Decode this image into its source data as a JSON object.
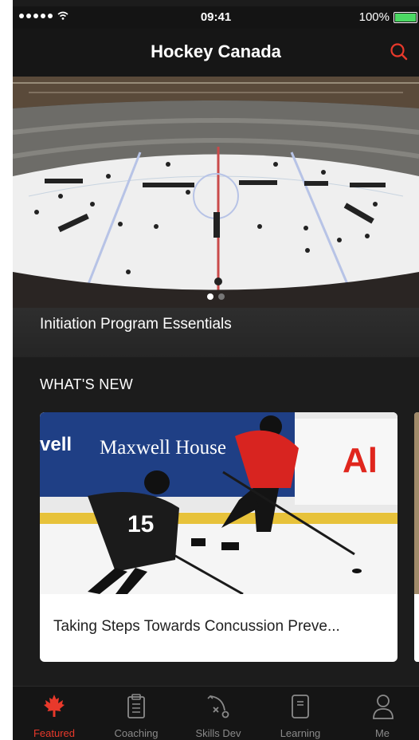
{
  "status_bar": {
    "time": "09:41",
    "battery": "100%"
  },
  "header": {
    "title": "Hockey Canada"
  },
  "hero": {
    "caption": "Initiation Program Essentials",
    "active_page": 1,
    "page_count": 2
  },
  "section": {
    "title": "WHAT'S NEW"
  },
  "cards": [
    {
      "title": "Taking Steps Towards Concussion Preve...",
      "banner_brand": "Maxwell House",
      "banner_partial_left": "vell",
      "banner_partial_right": "Al",
      "player_number": "15"
    }
  ],
  "tabs": [
    {
      "label": "Featured",
      "icon": "maple-leaf-icon",
      "active": true
    },
    {
      "label": "Coaching",
      "icon": "clipboard-icon",
      "active": false
    },
    {
      "label": "Skills Dev",
      "icon": "play-diagram-icon",
      "active": false
    },
    {
      "label": "Learning",
      "icon": "notebook-icon",
      "active": false
    },
    {
      "label": "Me",
      "icon": "person-icon",
      "active": false
    }
  ],
  "colors": {
    "accent": "#e8392b",
    "inactive": "#8a8a8a",
    "background": "#1c1c1c",
    "battery": "#4cd964"
  }
}
